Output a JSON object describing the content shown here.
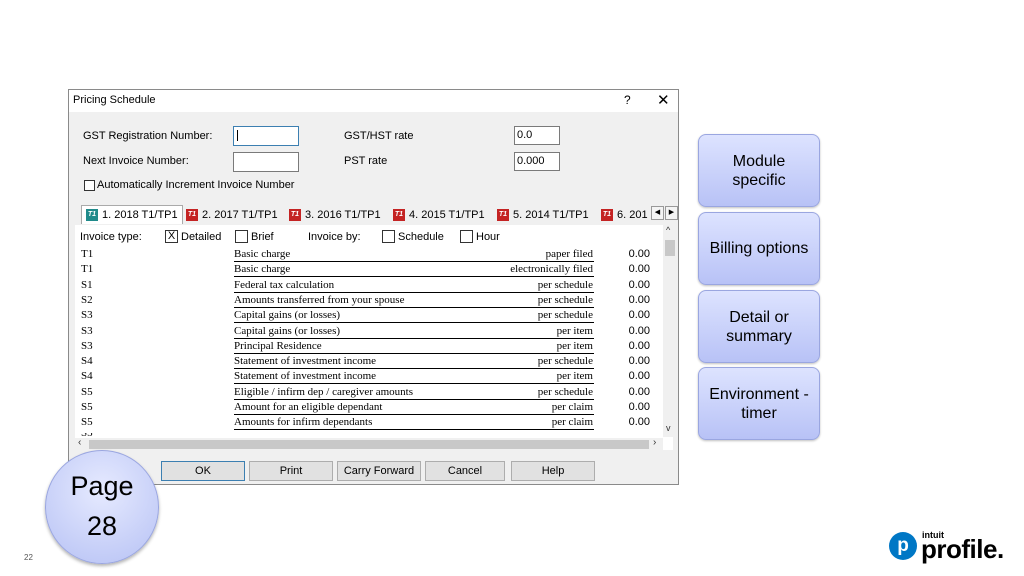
{
  "dialog": {
    "title": "Pricing Schedule",
    "help_glyph": "?",
    "close_glyph": "✕",
    "gst_label": "GST Registration Number:",
    "gst_value": "",
    "next_invoice_label": "Next Invoice Number:",
    "next_invoice_value": "",
    "auto_increment_label": "Automatically Increment Invoice Number",
    "auto_increment_checked": false,
    "gst_hst_rate_label": "GST/HST rate",
    "gst_hst_rate_value": "0.0",
    "pst_rate_label": "PST rate",
    "pst_rate_value": "0.000"
  },
  "tabs": [
    {
      "label": "1. 2018 T1/TP1",
      "icon": "T1",
      "active": true
    },
    {
      "label": "2. 2017 T1/TP1",
      "icon": "T1"
    },
    {
      "label": "3. 2016 T1/TP1",
      "icon": "T1"
    },
    {
      "label": "4. 2015 T1/TP1",
      "icon": "T1"
    },
    {
      "label": "5. 2014 T1/TP1",
      "icon": "T1"
    },
    {
      "label": "6. 201",
      "icon": "T1"
    }
  ],
  "options": {
    "invoice_type_label": "Invoice type:",
    "detailed_label": "Detailed",
    "detailed_checked": true,
    "detailed_mark": "X",
    "brief_label": "Brief",
    "invoice_by_label": "Invoice by:",
    "schedule_label": "Schedule",
    "hour_label": "Hour"
  },
  "rows": [
    {
      "code": "T1",
      "desc": "Basic charge",
      "unit": "paper filed",
      "amount": "0.00"
    },
    {
      "code": "T1",
      "desc": "Basic charge",
      "unit": "electronically filed",
      "amount": "0.00"
    },
    {
      "code": "S1",
      "desc": "Federal tax calculation",
      "unit": "per schedule",
      "amount": "0.00"
    },
    {
      "code": "S2",
      "desc": "Amounts transferred from your spouse",
      "unit": "per schedule",
      "amount": "0.00"
    },
    {
      "code": "S3",
      "desc": "Capital gains (or losses)",
      "unit": "per schedule",
      "amount": "0.00"
    },
    {
      "code": "S3",
      "desc": "Capital gains (or losses)",
      "unit": "per item",
      "amount": "0.00"
    },
    {
      "code": "S3",
      "desc": "Principal Residence",
      "unit": "per item",
      "amount": "0.00"
    },
    {
      "code": "S4",
      "desc": "Statement of investment income",
      "unit": "per schedule",
      "amount": "0.00"
    },
    {
      "code": "S4",
      "desc": "Statement of investment income",
      "unit": "per item",
      "amount": "0.00"
    },
    {
      "code": "S5",
      "desc": "Eligible / infirm dep / caregiver amounts",
      "unit": "per schedule",
      "amount": "0.00"
    },
    {
      "code": "S5",
      "desc": "Amount for an eligible dependant",
      "unit": "per claim",
      "amount": "0.00"
    },
    {
      "code": "S5",
      "desc": "Amounts for infirm dependants",
      "unit": "per claim",
      "amount": "0.00"
    }
  ],
  "buttons": {
    "ok": "OK",
    "print": "Print",
    "carry_forward": "Carry Forward",
    "cancel": "Cancel",
    "help": "Help"
  },
  "features": [
    {
      "label": "Module specific"
    },
    {
      "label": "Billing options"
    },
    {
      "label": "Detail or summary"
    },
    {
      "label": "Environment - timer"
    }
  ],
  "page_badge": {
    "line1": "Page",
    "line2": "28"
  },
  "slide_number": "22",
  "logo": {
    "small": "intuit",
    "word": "profile.",
    "mark": "p"
  }
}
